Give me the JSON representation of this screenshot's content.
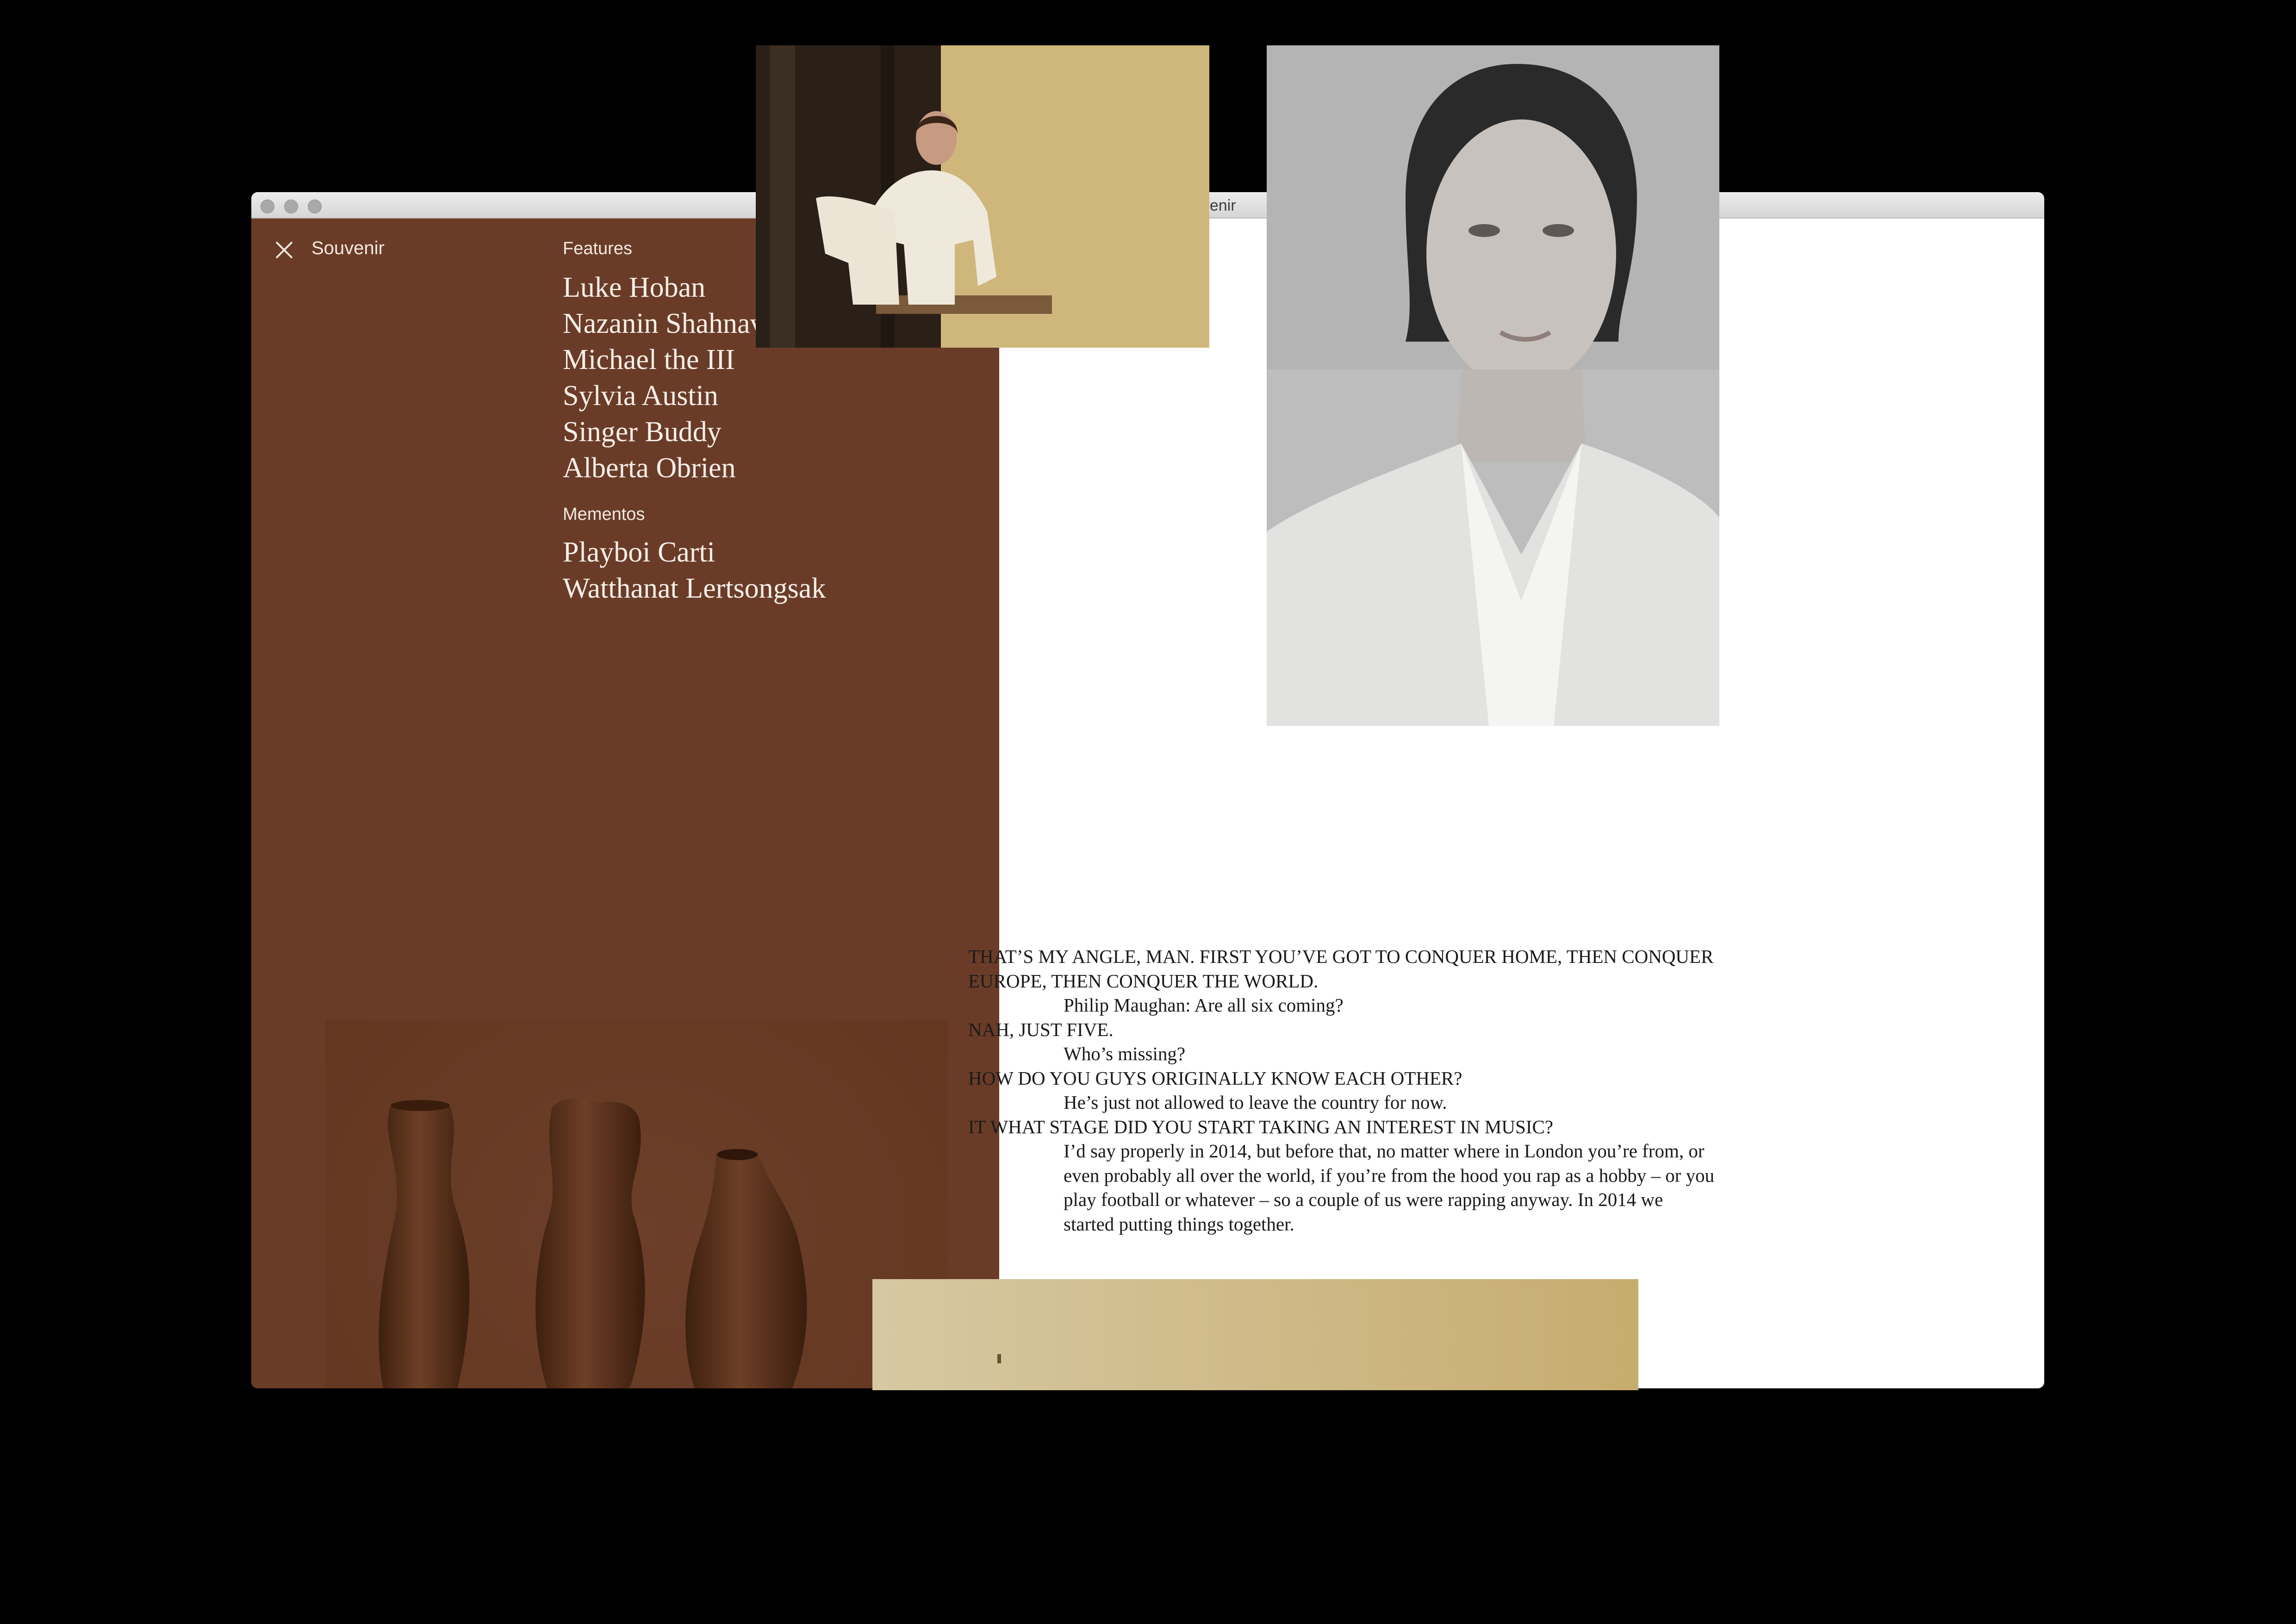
{
  "window": {
    "title": "Alberta Obrien | Souvenir"
  },
  "colors": {
    "panel": "#6a3c28",
    "panel_text": "#f7efe8",
    "page": "#ffffff"
  },
  "header": {
    "brand": "Souvenir",
    "close_icon": "close-icon"
  },
  "nav": {
    "features": {
      "label": "Features",
      "items": [
        "Luke Hoban",
        "Nazanin Shahnavaz",
        "Michael the III",
        "Sylvia Austin",
        "Singer Buddy",
        "Alberta Obrien"
      ]
    },
    "mementos": {
      "label": "Mementos",
      "items": [
        "Playboi Carti",
        "Watthanat Lertsongsak"
      ]
    }
  },
  "interview": [
    {
      "type": "q",
      "text": "THAT’S MY ANGLE, MAN. FIRST YOU’VE GOT TO CONQUER HOME, THEN CONQUER EUROPE, THEN CONQUER THE WORLD."
    },
    {
      "type": "a",
      "text": "Philip Maughan: Are all six coming?"
    },
    {
      "type": "q",
      "text": "NAH, JUST FIVE."
    },
    {
      "type": "a",
      "text": "Who’s missing?"
    },
    {
      "type": "q",
      "text": "HOW DO YOU GUYS ORIGINALLY KNOW EACH OTHER?"
    },
    {
      "type": "a",
      "text": "He’s just not allowed to leave the country for now."
    },
    {
      "type": "q",
      "text": "IT WHAT STAGE DID YOU START TAKING AN INTEREST IN MUSIC?"
    },
    {
      "type": "a",
      "text": "I’d say properly in 2014, but before that, no matter where in London you’re from, or even probably all over the world, if you’re from the hood you rap as a hobby – or you play football or whatever – so a couple of us were rapping anyway. In 2014 we started putting things together."
    }
  ]
}
